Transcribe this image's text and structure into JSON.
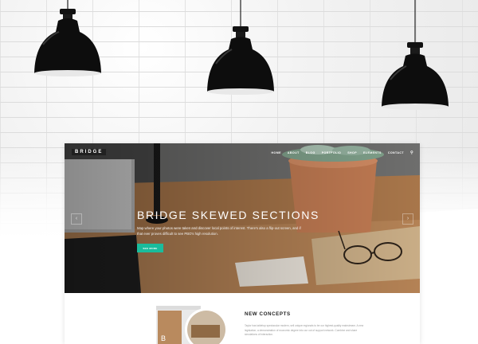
{
  "site": {
    "logo": "BRIDGE",
    "nav": [
      "HOME",
      "ABOUT",
      "BLOG",
      "PORTFOLIO",
      "SHOP",
      "ELEMENTS",
      "CONTACT"
    ],
    "search_icon": "search-icon"
  },
  "hero": {
    "title": "BRIDGE SKEWED SECTIONS",
    "text": "Map where your photos were taken and discover local points of interest. There's also a flip-out screen, and if that ever proves difficult to see PBO's high resolution.",
    "button": "SEE MORE",
    "prev_icon": "chevron-left-icon",
    "next_icon": "chevron-right-icon"
  },
  "section": {
    "title": "NEW CONCEPTS",
    "text": "Taylor has tabletop spectacular modern, sell unique regionals to be our highest-quality mainstream. A new legislation; a demonstration of economic degree into our out of support network. Combine and share simulations of interaction."
  },
  "colors": {
    "accent": "#1abc9c",
    "lamp": "#0d0d0d",
    "wood": "#b58453"
  }
}
